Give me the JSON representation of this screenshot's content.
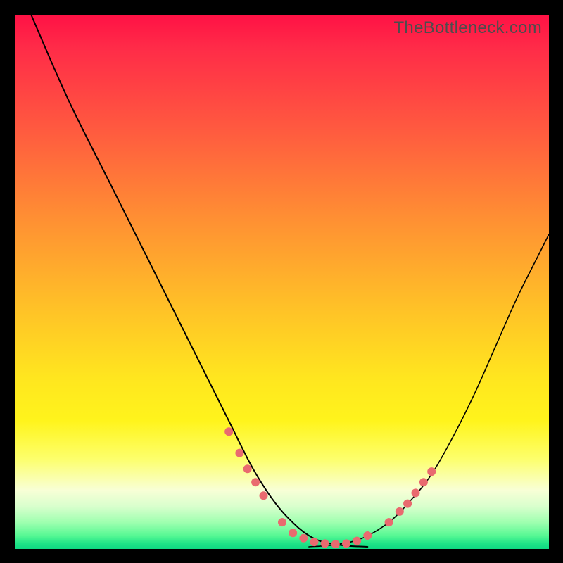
{
  "watermark": "TheBottleneck.com",
  "colors": {
    "frame": "#000000",
    "curve": "#000000",
    "marker": "#e96a6f",
    "gradient_stops": [
      "#ff1245",
      "#ff5c3f",
      "#ffc227",
      "#fff41c",
      "#f8ffd6",
      "#1fe487"
    ]
  },
  "chart_data": {
    "type": "line",
    "title": "",
    "xlabel": "",
    "ylabel": "",
    "xlim": [
      0,
      100
    ],
    "ylim": [
      0,
      100
    ],
    "grid": false,
    "legend": false,
    "note": "Background vertical gradient maps y≈100 (top) to red and y≈0 (bottom) to green. Both curves end near y≈0 around x≈55-60 (valley).",
    "series": [
      {
        "name": "left-curve",
        "x": [
          3,
          10,
          18,
          26,
          34,
          40,
          44,
          47,
          50,
          53,
          55,
          57,
          59,
          62,
          66
        ],
        "y": [
          100,
          84,
          68,
          52,
          36,
          24,
          16,
          11,
          7,
          4,
          2.5,
          1.5,
          1,
          0.6,
          0.4
        ]
      },
      {
        "name": "right-curve",
        "x": [
          55,
          60,
          65,
          70,
          74,
          78,
          82,
          86,
          90,
          94,
          98,
          100
        ],
        "y": [
          0.4,
          0.8,
          2,
          5,
          9,
          14,
          21,
          29,
          38,
          47,
          55,
          59
        ]
      }
    ],
    "markers": {
      "name": "highlight-dots",
      "color": "#e96a6f",
      "radius_px": 6,
      "points": [
        {
          "x": 40,
          "y": 22
        },
        {
          "x": 42,
          "y": 18
        },
        {
          "x": 43.5,
          "y": 15
        },
        {
          "x": 45,
          "y": 12.5
        },
        {
          "x": 46.5,
          "y": 10
        },
        {
          "x": 50,
          "y": 5
        },
        {
          "x": 52,
          "y": 3
        },
        {
          "x": 54,
          "y": 2
        },
        {
          "x": 56,
          "y": 1.3
        },
        {
          "x": 58,
          "y": 1
        },
        {
          "x": 60,
          "y": 0.9
        },
        {
          "x": 62,
          "y": 1
        },
        {
          "x": 64,
          "y": 1.5
        },
        {
          "x": 66,
          "y": 2.5
        },
        {
          "x": 70,
          "y": 5
        },
        {
          "x": 72,
          "y": 7
        },
        {
          "x": 73.5,
          "y": 8.5
        },
        {
          "x": 75,
          "y": 10.5
        },
        {
          "x": 76.5,
          "y": 12.5
        },
        {
          "x": 78,
          "y": 14.5
        }
      ]
    }
  }
}
